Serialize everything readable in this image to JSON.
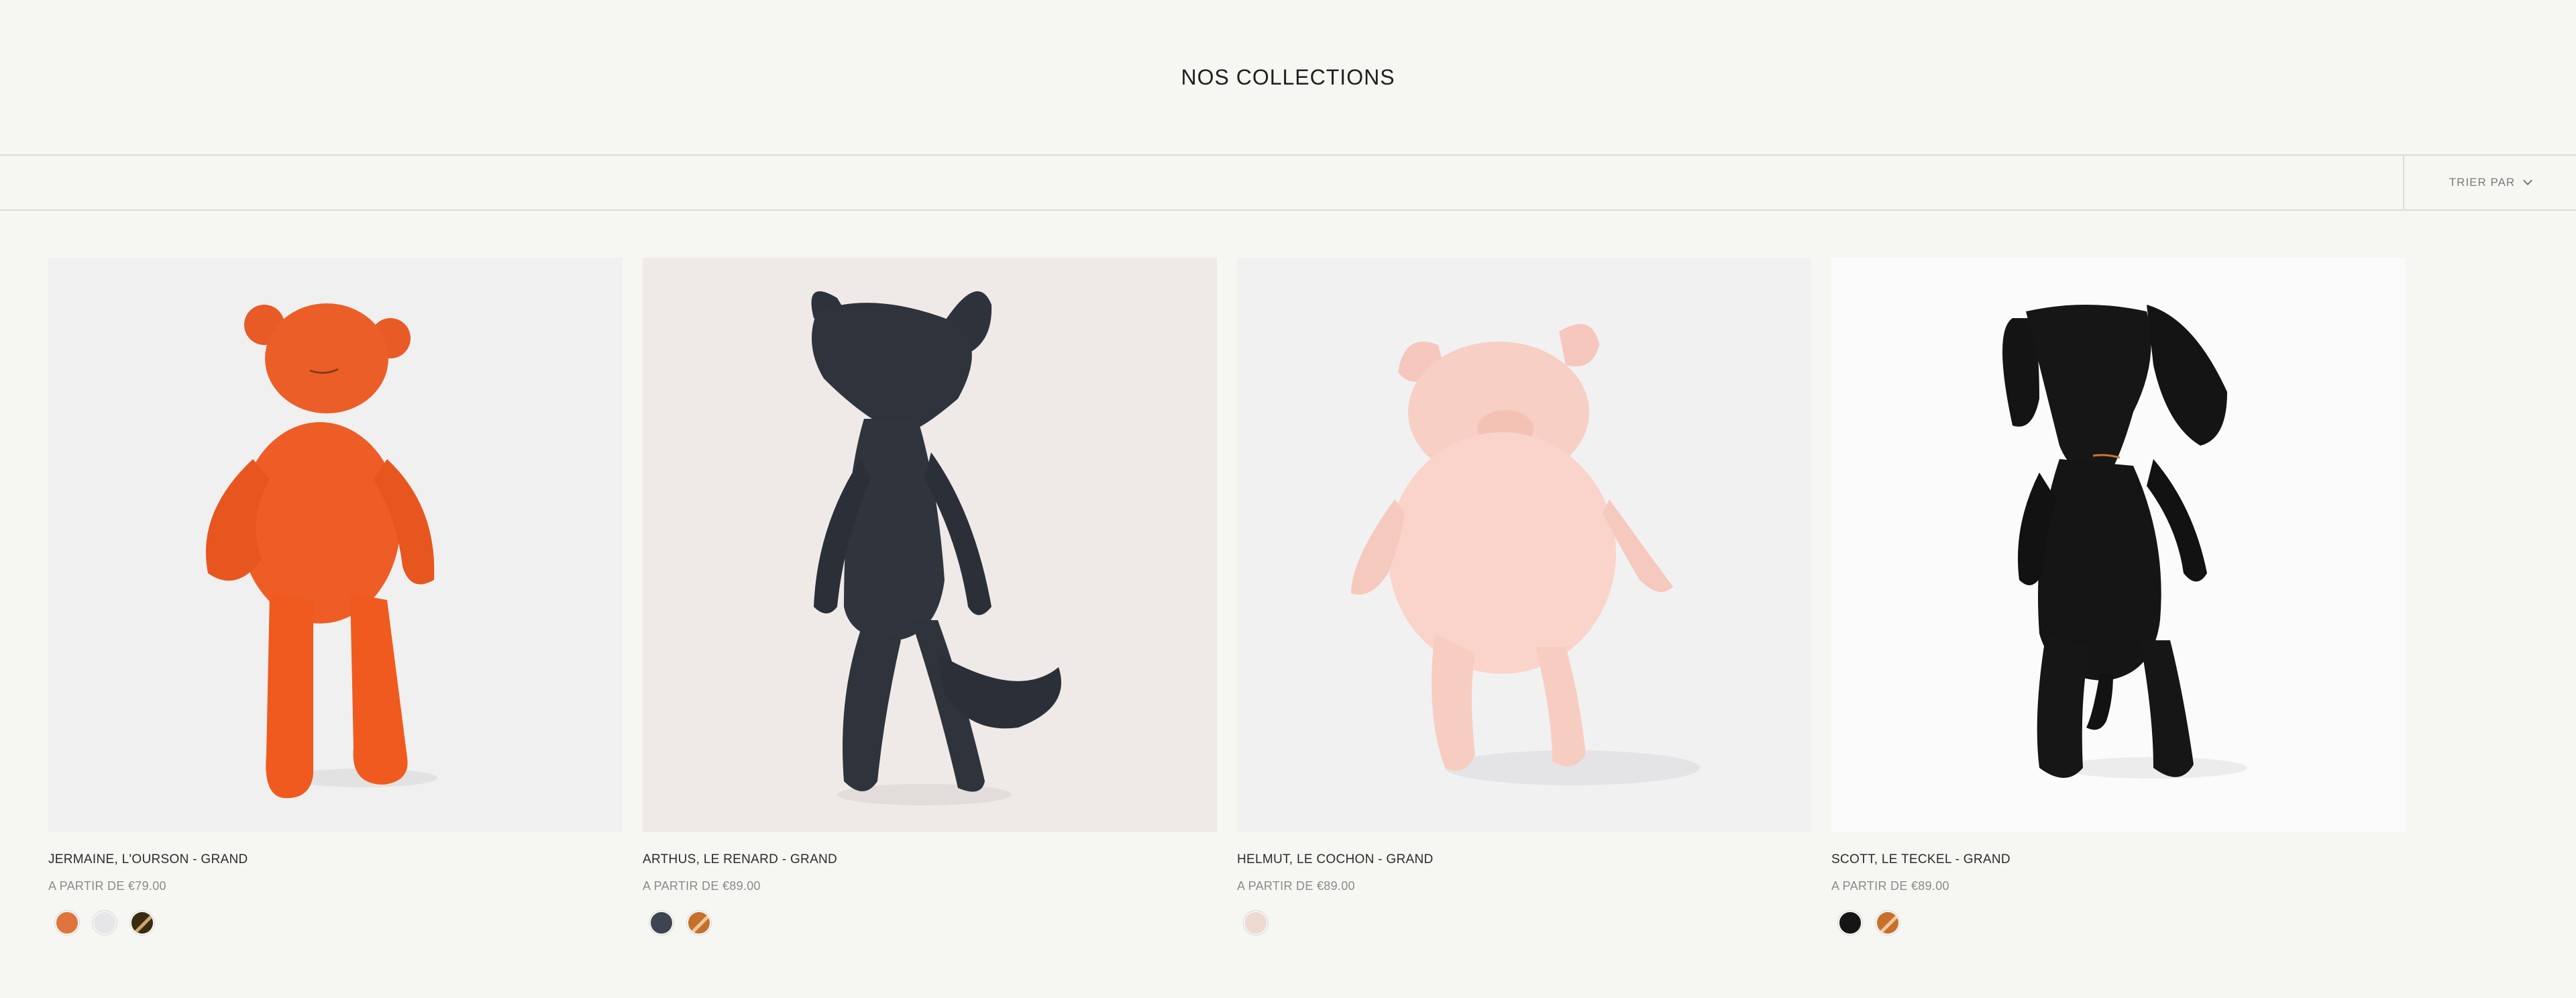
{
  "header": {
    "title": "NOS COLLECTIONS"
  },
  "toolbar": {
    "sort_label": "TRIER PAR",
    "sort_icon": "chevron-down-icon"
  },
  "products": [
    {
      "name": "JERMAINE, L'OURSON - GRAND",
      "price": "A PARTIR DE €79.00",
      "image": "orange-bear-plush",
      "background": "#f0f0f0",
      "swatches": [
        {
          "color": "#e0743d",
          "label": "orange"
        },
        {
          "color": "#e6e6e8",
          "label": "white"
        },
        {
          "color": "#3a2a10",
          "label": "dark-brown",
          "style": "split",
          "alt": "#c9a66b"
        }
      ]
    },
    {
      "name": "ARTHUS, LE RENARD - GRAND",
      "price": "A PARTIR DE €89.00",
      "image": "dark-fox-plush",
      "background": "#efeae8",
      "swatches": [
        {
          "color": "#3e4550",
          "label": "navy"
        },
        {
          "color": "#c7702b",
          "label": "orange",
          "style": "split",
          "alt": "#f0c9a0"
        }
      ]
    },
    {
      "name": "HELMUT, LE COCHON - GRAND",
      "price": "A PARTIR DE €89.00",
      "image": "pink-pig-plush",
      "background": "#f1f1f2",
      "swatches": [
        {
          "color": "#ecd9cf",
          "label": "pink"
        }
      ]
    },
    {
      "name": "SCOTT, LE TECKEL - GRAND",
      "price": "A PARTIR DE €89.00",
      "image": "black-dachshund-plush",
      "background": "#fbfbfb",
      "swatches": [
        {
          "color": "#151515",
          "label": "black"
        },
        {
          "color": "#c7702b",
          "label": "orange",
          "style": "split",
          "alt": "#f0c9a0"
        }
      ]
    }
  ]
}
